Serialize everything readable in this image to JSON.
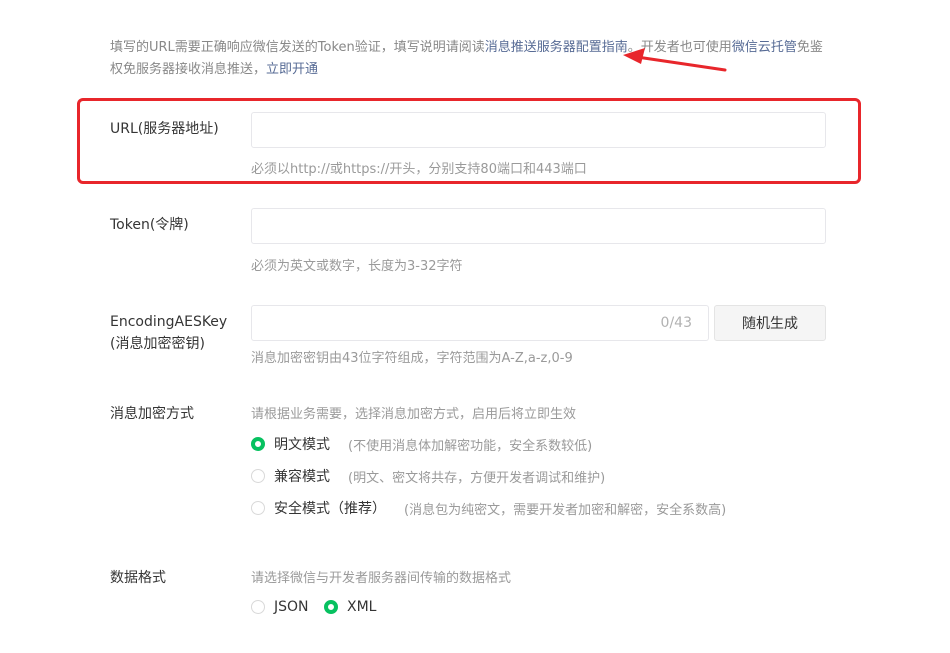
{
  "intro": {
    "text1": "填写的URL需要正确响应微信发送的Token验证，填写说明请阅读",
    "link1": "消息推送服务器配置指南",
    "text2": "。开发者也可使用",
    "link2": "微信云托管",
    "text3": "免鉴权免服务器接收消息推送，",
    "link3": "立即开通"
  },
  "url": {
    "label": "URL(服务器地址)",
    "value": "",
    "hint": "必须以http://或https://开头，分别支持80端口和443端口"
  },
  "token": {
    "label": "Token(令牌)",
    "value": "",
    "hint": "必须为英文或数字，长度为3-32字符"
  },
  "aes": {
    "label_line1": "EncodingAESKey",
    "label_line2": "(消息加密密钥)",
    "value": "",
    "counter": "0/43",
    "generate_button": "随机生成",
    "hint": "消息加密密钥由43位字符组成，字符范围为A-Z,a-z,0-9"
  },
  "encrypt": {
    "label": "消息加密方式",
    "hint": "请根据业务需要，选择消息加密方式，启用后将立即生效",
    "options": [
      {
        "label": "明文模式",
        "desc": "(不使用消息体加解密功能，安全系数较低)",
        "checked": true
      },
      {
        "label": "兼容模式",
        "desc": "(明文、密文将共存，方便开发者调试和维护)",
        "checked": false
      },
      {
        "label": "安全模式（推荐）",
        "desc": "(消息包为纯密文，需要开发者加密和解密，安全系数高)",
        "checked": false
      }
    ]
  },
  "format": {
    "label": "数据格式",
    "hint": "请选择微信与开发者服务器间传输的数据格式",
    "options": [
      {
        "label": "JSON",
        "checked": false
      },
      {
        "label": "XML",
        "checked": true
      }
    ]
  },
  "colors": {
    "accent": "#07c160",
    "link": "#576b95",
    "annotation": "#e8262b"
  }
}
